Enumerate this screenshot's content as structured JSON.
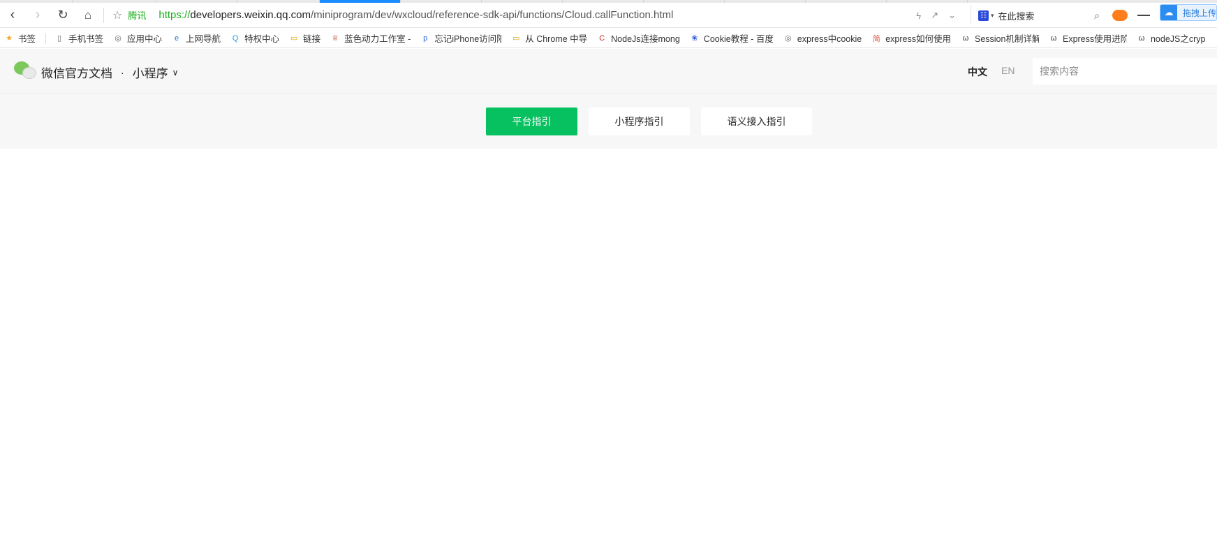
{
  "browser": {
    "nav": {
      "back_icon": "chevron-left-icon",
      "forward_icon": "chevron-right-icon",
      "reload_icon": "reload-icon",
      "home_icon": "home-icon"
    },
    "site_label": "腾讯",
    "url": {
      "scheme": "https://",
      "host": "developers.weixin.qq.com",
      "path": "/miniprogram/dev/wxcloud/reference-sdk-api/functions/Cloud.callFunction.html"
    },
    "search_placeholder": "在此搜索",
    "upload_label": "拖拽上传"
  },
  "bookmarks": [
    {
      "label": "书签",
      "icon": "star-icon"
    },
    {
      "label": "手机书签",
      "icon": "phone-icon"
    },
    {
      "label": "应用中心",
      "icon": "globe-icon"
    },
    {
      "label": "上网导航",
      "icon": "ie-icon"
    },
    {
      "label": "特权中心",
      "icon": "q-icon"
    },
    {
      "label": "链接",
      "icon": "folder-icon"
    },
    {
      "label": "蓝色动力工作室 -",
      "icon": "crown-icon"
    },
    {
      "label": "忘记iPhone访问限",
      "icon": "p-icon"
    },
    {
      "label": "从 Chrome 中导",
      "icon": "folder-icon"
    },
    {
      "label": "NodeJs连接mong",
      "icon": "c-icon"
    },
    {
      "label": "Cookie教程 - 百度",
      "icon": "paw-icon"
    },
    {
      "label": "express中cookie",
      "icon": "globe-icon"
    },
    {
      "label": "express如何使用",
      "icon": "jian-icon"
    },
    {
      "label": "Session机制详解",
      "icon": "w-icon"
    },
    {
      "label": "Express使用进阶",
      "icon": "w-icon"
    },
    {
      "label": "nodeJS之cryp",
      "icon": "w-icon"
    }
  ],
  "header": {
    "brand": "微信官方文档",
    "separator": "·",
    "product": "小程序",
    "lang_zh": "中文",
    "lang_en": "EN",
    "search_placeholder": "搜索内容"
  },
  "guides": [
    {
      "label": "平台指引",
      "active": true
    },
    {
      "label": "小程序指引",
      "active": false
    },
    {
      "label": "语义接入指引",
      "active": false
    }
  ],
  "colors": {
    "accent": "#07c160",
    "url_scheme": "#1aad19",
    "tab_active": "#1a8cff"
  }
}
